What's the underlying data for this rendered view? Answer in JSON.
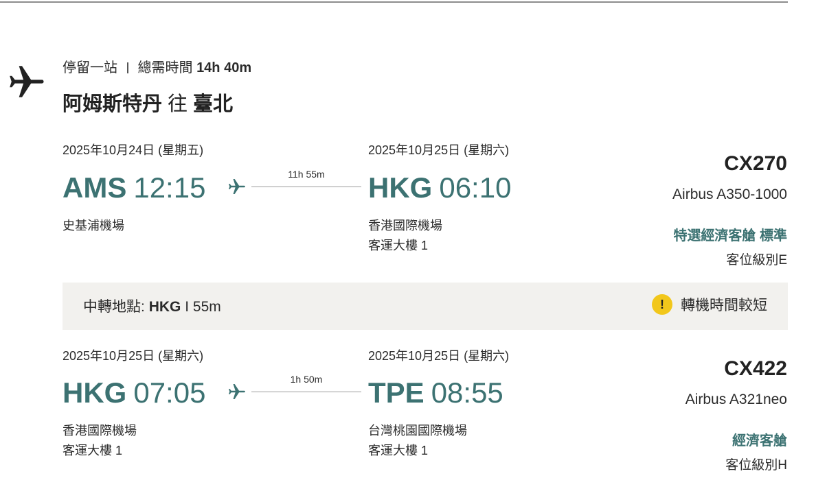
{
  "summary": {
    "stops": "停留一站",
    "total_label": "總需時間",
    "total_time": "14h 40m"
  },
  "route": {
    "from": "阿姆斯特丹",
    "connector": "往",
    "to": "臺北"
  },
  "segments": [
    {
      "dep_date": "2025年10月24日 (星期五)",
      "dep_code": "AMS",
      "dep_time": "12:15",
      "dep_airport": "史基浦機場",
      "dep_terminal": "",
      "duration": "11h 55m",
      "arr_date": "2025年10月25日 (星期六)",
      "arr_code": "HKG",
      "arr_time": "06:10",
      "arr_airport": "香港國際機場",
      "arr_terminal": "客運大樓 1",
      "flight_no": "CX270",
      "aircraft": "Airbus A350-1000",
      "cabin": "特選經濟客艙 標準",
      "fare_class": "客位級別E"
    },
    {
      "dep_date": "2025年10月25日 (星期六)",
      "dep_code": "HKG",
      "dep_time": "07:05",
      "dep_airport": "香港國際機場",
      "dep_terminal": "客運大樓 1",
      "duration": "1h 50m",
      "arr_date": "2025年10月25日 (星期六)",
      "arr_code": "TPE",
      "arr_time": "08:55",
      "arr_airport": "台灣桃園國際機場",
      "arr_terminal": "客運大樓 1",
      "flight_no": "CX422",
      "aircraft": "Airbus A321neo",
      "cabin": "經濟客艙",
      "fare_class": "客位級別H"
    }
  ],
  "transit": {
    "label": "中轉地點:",
    "airport": "HKG",
    "separator": "I",
    "duration": "55m",
    "warning": "轉機時間較短",
    "warning_icon": "!"
  },
  "colors": {
    "accent": "#3c7272",
    "warning": "#f2c71b",
    "transit_bg": "#f2f1ee"
  }
}
